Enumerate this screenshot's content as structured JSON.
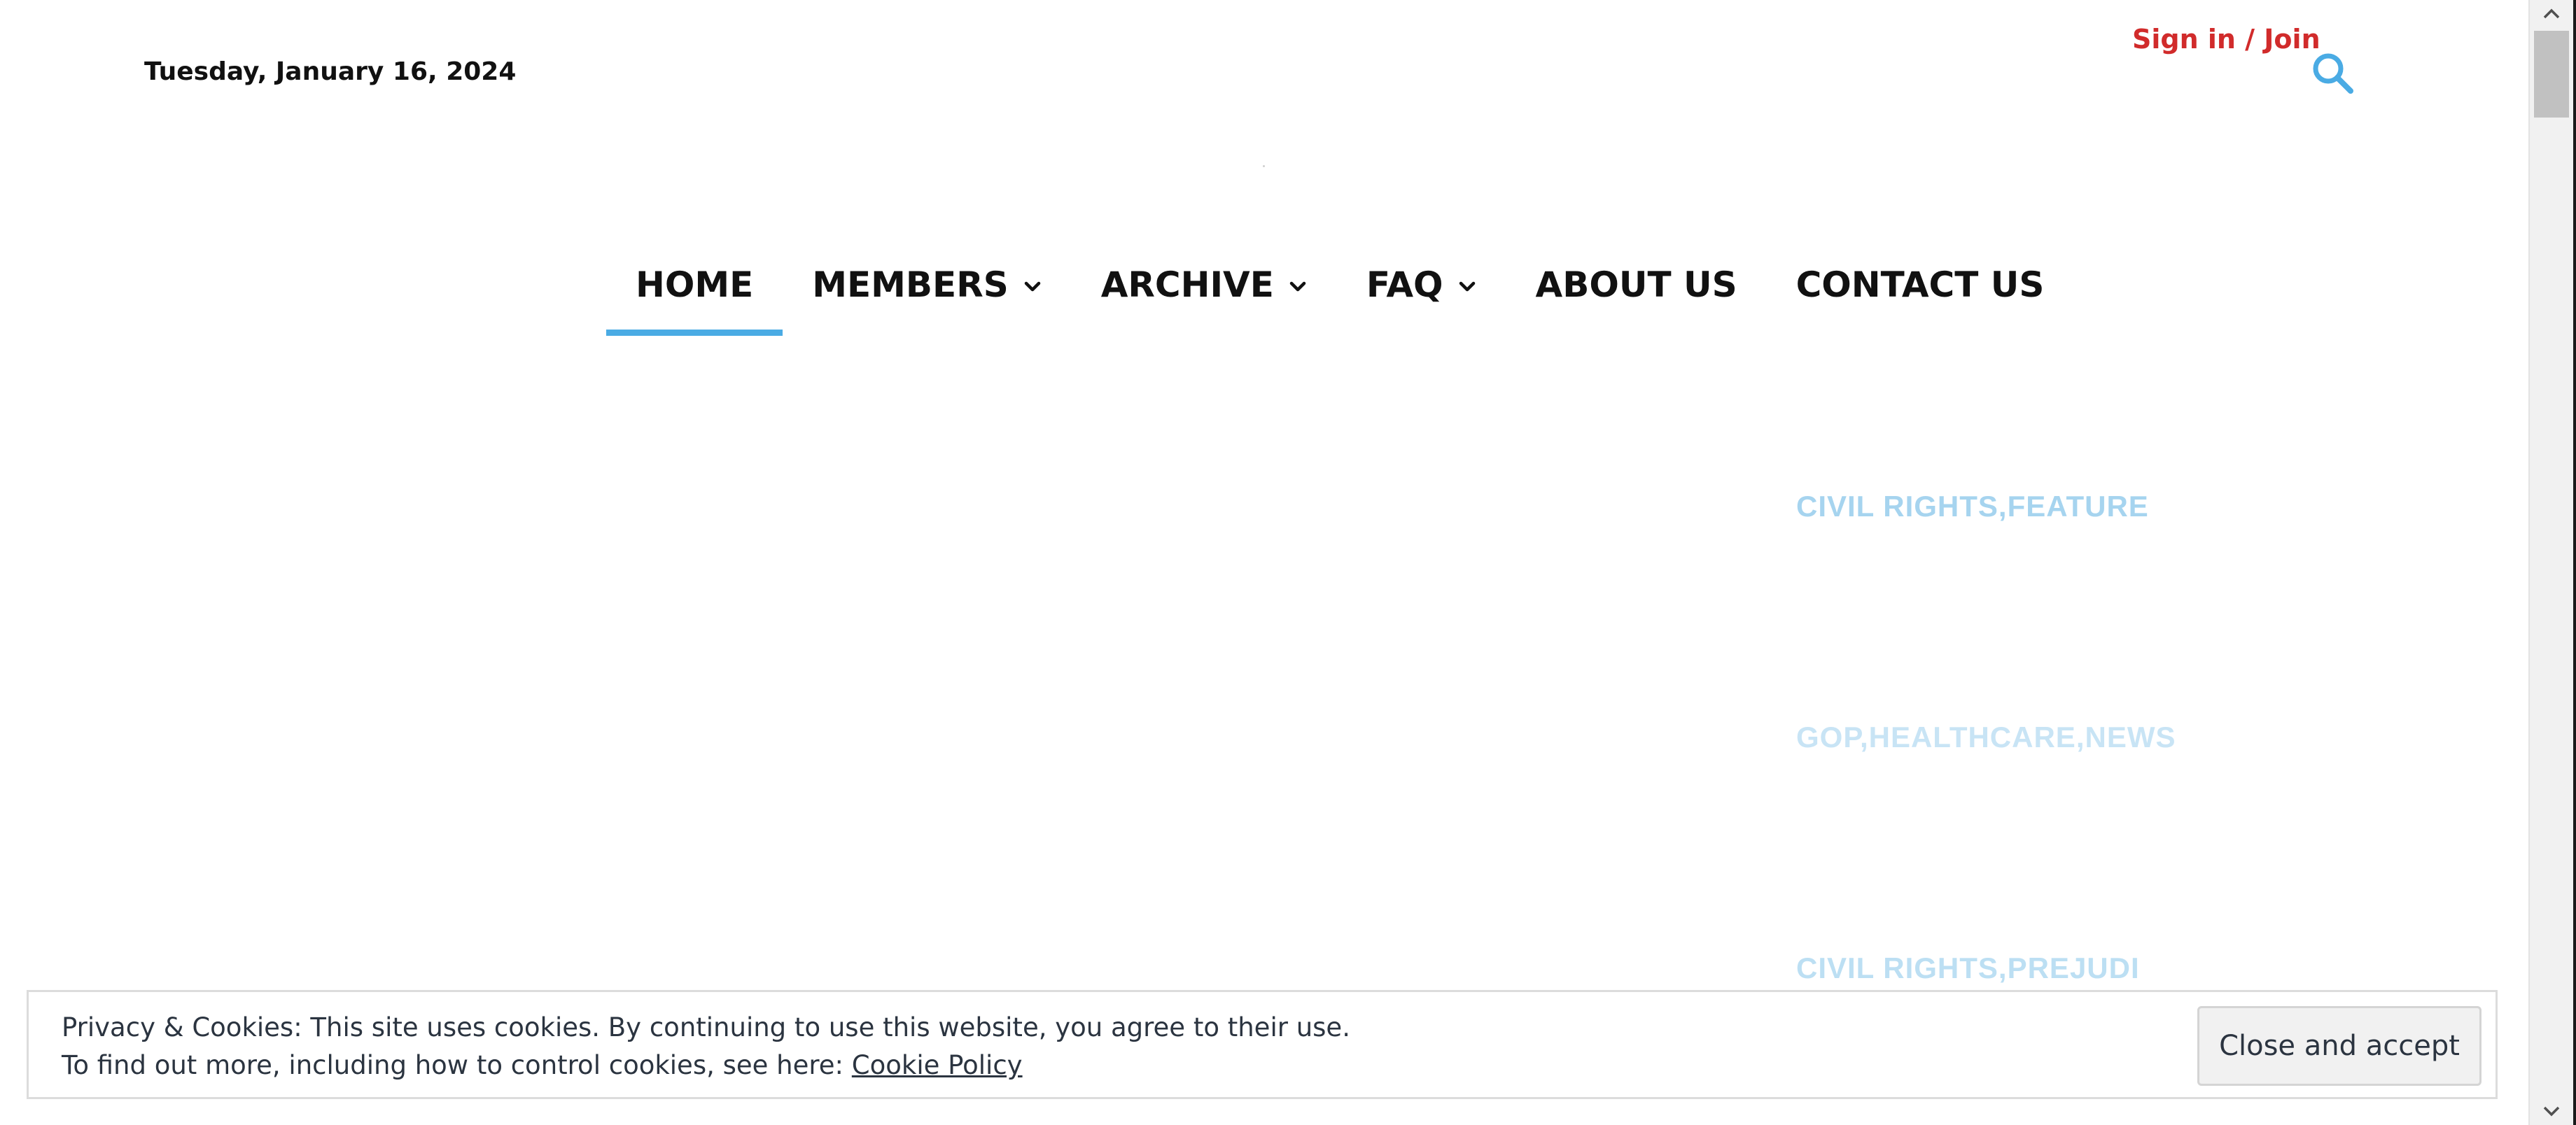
{
  "header": {
    "date": "Tuesday, January 16, 2024",
    "signin_label": "Sign in / Join",
    "search_icon": "search-icon"
  },
  "nav": {
    "items": [
      {
        "label": "HOME",
        "active": true,
        "has_dropdown": false
      },
      {
        "label": "MEMBERS",
        "active": false,
        "has_dropdown": true
      },
      {
        "label": "ARCHIVE",
        "active": false,
        "has_dropdown": true
      },
      {
        "label": "FAQ",
        "active": false,
        "has_dropdown": true
      },
      {
        "label": "ABOUT US",
        "active": false,
        "has_dropdown": false
      },
      {
        "label": "CONTACT US",
        "active": false,
        "has_dropdown": false
      }
    ],
    "dropdown_icon": "chevron-down-icon"
  },
  "categories": [
    "CIVIL RIGHTS,FEATURE",
    "GOP,HEALTHCARE,NEWS",
    "CIVIL RIGHTS,PREJUDI"
  ],
  "cookie_banner": {
    "line1": "Privacy & Cookies: This site uses cookies. By continuing to use this website, you agree to their use.",
    "line2_prefix": "To find out more, including how to control cookies, see here: ",
    "link_label": "Cookie Policy",
    "button_label": "Close and accept"
  },
  "colors": {
    "accent": "#4aabe4",
    "signin": "#d12b2b",
    "category": "#a6d4ef",
    "text": "#111111"
  }
}
